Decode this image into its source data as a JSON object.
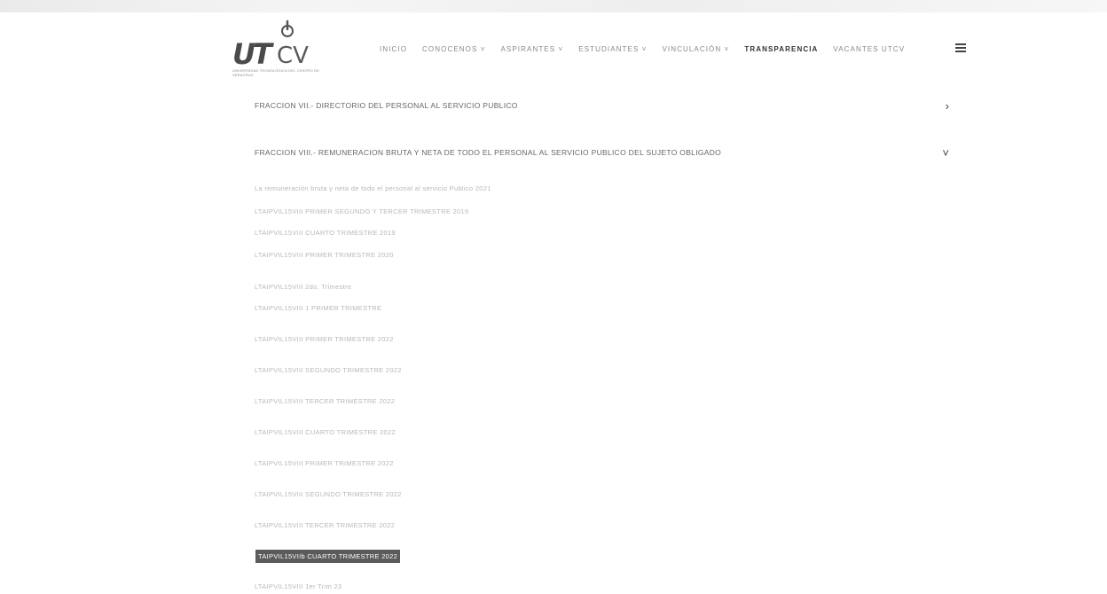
{
  "brand": {
    "logo_text": "UT",
    "logo_suffix": "CV",
    "subtitle": "UNIVERSIDAD TECNOLÓGICA DEL CENTRO DE VERACRUZ"
  },
  "nav": {
    "items": [
      {
        "label": "INICIO",
        "active": false
      },
      {
        "label": "CONOCENOS ˅",
        "active": false
      },
      {
        "label": "ASPIRANTES ˅",
        "active": false
      },
      {
        "label": "ESTUDIANTES ˅",
        "active": false
      },
      {
        "label": "VINCULACIÓN ˅",
        "active": false
      },
      {
        "label": "TRANSPARENCIA",
        "active": true
      },
      {
        "label": "VACANTES UTCV",
        "active": false
      }
    ],
    "menu_icon": "hamburger-icon"
  },
  "sections": [
    {
      "title": "FRACCION VII.- DIRECTORIO DEL PERSONAL AL SERVICIO PUBLICO",
      "chevron": "›",
      "expanded": false
    },
    {
      "title": "FRACCION VIII.- REMUNERACION BRUTA Y NETA DE TODO EL PERSONAL AL SERVICIO PUBLICO DEL SUJETO OBLIGADO",
      "chevron": "˅",
      "expanded": true
    }
  ],
  "documents": [
    {
      "label": "La remuneración bruta y neta de todo el personal al servicio Publico 2021"
    },
    {
      "label": "LTAIPVIL15VIII PRIMER SEGUNDO Y TERCER TRIMESTRE 2019"
    },
    {
      "label": "LTAIPVIL15VIII CUARTO TRIMESTRE 2019"
    },
    {
      "label": "LTAIPVIL15VIII PRIMER TRIMESTRE 2020"
    },
    {
      "label": "LTAIPVIL15VIII 2do. Trimestre"
    },
    {
      "label": "LTAIPVIL15VIII 1 PRIMER TRIMESTRE"
    },
    {
      "label": "LTAIPVIL15VIII PRIMER TRIMESTRE 2022"
    },
    {
      "label": "LTAIPVIL15VIII SEGUNDO TRIMESTRE 2022"
    },
    {
      "label": "LTAIPVIL15VIII TERCER TRIMESTRE 2022"
    },
    {
      "label": "LTAIPVIL15VIII CUARTO TRIMESTRE 2022"
    },
    {
      "label": "LTAIPVIL15VIII PRIMER TRIMESTRE 2022"
    },
    {
      "label": "LTAIPVIL15VIII SEGUNDO TRIMESTRE 2022"
    },
    {
      "label": "LTAIPVIL15VIII TERCER TRIMESTRE 2022"
    },
    {
      "label": "TAIPVIL15VIIb CUARTO TRIMESTRE 2022",
      "highlighted": true
    },
    {
      "label": "LTAIPVIL15VIII 1er Trim 23"
    }
  ],
  "colors": {
    "active_nav": "#333333",
    "inactive_nav": "#888888",
    "highlight_bg": "#5b5b5b"
  }
}
